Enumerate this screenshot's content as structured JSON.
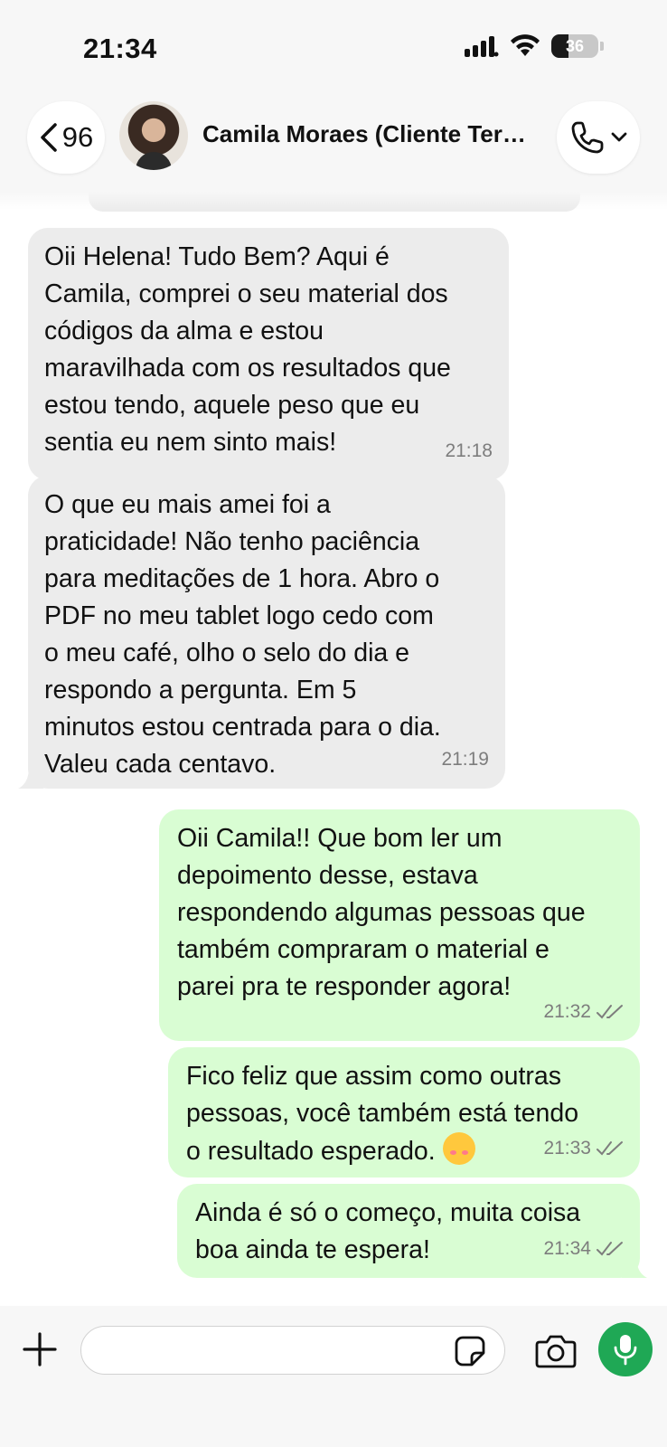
{
  "status_bar": {
    "time": "21:34",
    "battery_level": "36"
  },
  "header": {
    "back_count": "96",
    "contact_name": "Camila Moraes (Cliente Terapia)",
    "icons": [
      "chevron-left-icon",
      "phone-icon",
      "chevron-down-icon"
    ]
  },
  "messages": [
    {
      "direction": "incoming",
      "text": "Oii Helena! Tudo Bem? Aqui é\nCamila, comprei o seu material dos\ncódigos da alma e estou\nmaravilhada com os resultados que\nestou tendo, aquele peso que eu\nsentia eu nem sinto mais!",
      "time": "21:18"
    },
    {
      "direction": "incoming",
      "text": "O que eu mais amei foi a\npraticidade! Não tenho paciência\npara meditações de 1 hora. Abro o\nPDF no meu tablet logo cedo com\no meu café, olho o selo do dia e\nrespondo a pergunta. Em 5\nminutos estou centrada para o dia.\nValeu cada centavo.",
      "time": "21:19"
    },
    {
      "direction": "outgoing",
      "text": "Oii Camila!! Que bom ler um\ndepoimento desse, estava\nrespondendo algumas pessoas que\ntambém compraram o material e\nparei pra te responder agora!",
      "time": "21:32",
      "status": "read"
    },
    {
      "direction": "outgoing",
      "text": "Fico feliz que assim como outras\npessoas, você também está tendo\no resultado esperado.",
      "emoji": "smiling-face-with-hearts",
      "time": "21:33",
      "status": "read"
    },
    {
      "direction": "outgoing",
      "text": "Ainda é só o começo, muita coisa\nboa ainda te espera!",
      "time": "21:34",
      "status": "read"
    }
  ],
  "input_bar": {
    "message_value": "",
    "icons": [
      "plus-icon",
      "sticker-icon",
      "camera-icon",
      "microphone-icon"
    ]
  },
  "colors": {
    "incoming_bubble": "#ececec",
    "outgoing_bubble": "#d9fdd3",
    "accent_green": "#1fa855",
    "bar_background": "#f7f7f7"
  }
}
